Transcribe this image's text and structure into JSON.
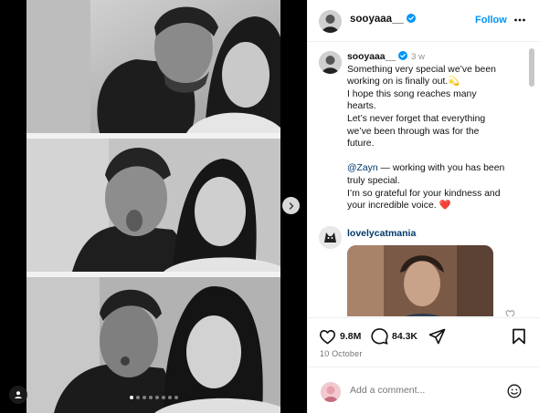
{
  "post": {
    "author": "sooyaaa__",
    "follow_label": "Follow",
    "time_ago": "3 w",
    "caption_lines": [
      "Something very special we’ve been",
      "working on is finally out.💫",
      "I hope this song reaches many",
      "hearts.",
      "Let’s never forget that everything",
      "we’ve been through was for the",
      "future."
    ],
    "caption_mention": "@Zayn",
    "caption_mention_rest": " — working with you has been",
    "caption_lines_2": [
      "truly special.",
      "I’m so grateful for your kindness and",
      "your incredible voice. ❤️"
    ],
    "likes": "9.8M",
    "comments_count": "84.3K",
    "date": "10 October",
    "media_dots": 8,
    "media_active_dot": 0
  },
  "comment": {
    "author": "lovelycatmania"
  },
  "composer": {
    "placeholder": "Add a comment..."
  },
  "icons": {
    "verified": "verified-badge-icon",
    "more": "more-options-icon",
    "heart": "heart-icon",
    "comment": "comment-icon",
    "share": "share-icon",
    "bookmark": "bookmark-icon",
    "emoji": "emoji-icon",
    "next": "chevron-right-icon",
    "tag": "user-tag-icon"
  },
  "colors": {
    "accent": "#0095f6",
    "mention": "#00376b",
    "muted": "#8e8e8e"
  }
}
